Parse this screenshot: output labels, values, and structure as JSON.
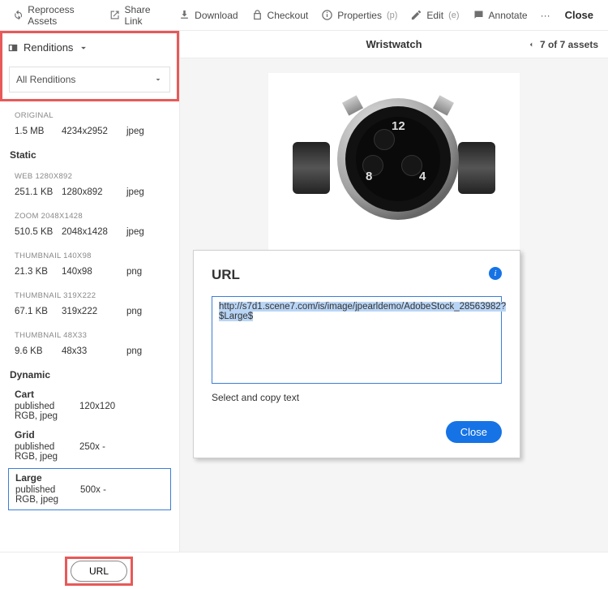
{
  "toolbar": {
    "reprocess": "Reprocess Assets",
    "share": "Share Link",
    "download": "Download",
    "checkout": "Checkout",
    "properties": "Properties",
    "prop_key": "(p)",
    "edit": "Edit",
    "edit_key": "(e)",
    "annotate": "Annotate",
    "more": "···",
    "close": "Close"
  },
  "sidebar": {
    "renditions_label": "Renditions",
    "filter": "All Renditions",
    "labels": {
      "original": "ORIGINAL",
      "web": "WEB 1280X892",
      "zoom": "ZOOM 2048X1428",
      "thumb1": "THUMBNAIL 140X98",
      "thumb2": "THUMBNAIL 319X222",
      "thumb3": "THUMBNAIL 48X33"
    },
    "rows": {
      "original": {
        "size": "1.5 MB",
        "dim": "4234x2952",
        "fmt": "jpeg"
      },
      "web": {
        "size": "251.1 KB",
        "dim": "1280x892",
        "fmt": "jpeg"
      },
      "zoom": {
        "size": "510.5 KB",
        "dim": "2048x1428",
        "fmt": "jpeg"
      },
      "th1": {
        "size": "21.3 KB",
        "dim": "140x98",
        "fmt": "png"
      },
      "th2": {
        "size": "67.1 KB",
        "dim": "319x222",
        "fmt": "png"
      },
      "th3": {
        "size": "9.6 KB",
        "dim": "48x33",
        "fmt": "png"
      }
    },
    "static_header": "Static",
    "dynamic_header": "Dynamic",
    "dyn": {
      "cart": {
        "name": "Cart",
        "status": "published",
        "dim": "120x120",
        "fmt": "RGB, jpeg"
      },
      "grid": {
        "name": "Grid",
        "status": "published",
        "dim": "250x -",
        "fmt": "RGB, jpeg"
      },
      "large": {
        "name": "Large",
        "status": "published",
        "dim": "500x -",
        "fmt": "RGB, jpeg"
      }
    }
  },
  "preview": {
    "title": "Wristwatch",
    "count": "7 of 7 assets"
  },
  "modal": {
    "title": "URL",
    "url": "http://s7d1.scene7.com/is/image/jpearldemo/AdobeStock_28563982?$Large$",
    "hint": "Select and copy text",
    "close": "Close"
  },
  "footer": {
    "url_button": "URL"
  }
}
